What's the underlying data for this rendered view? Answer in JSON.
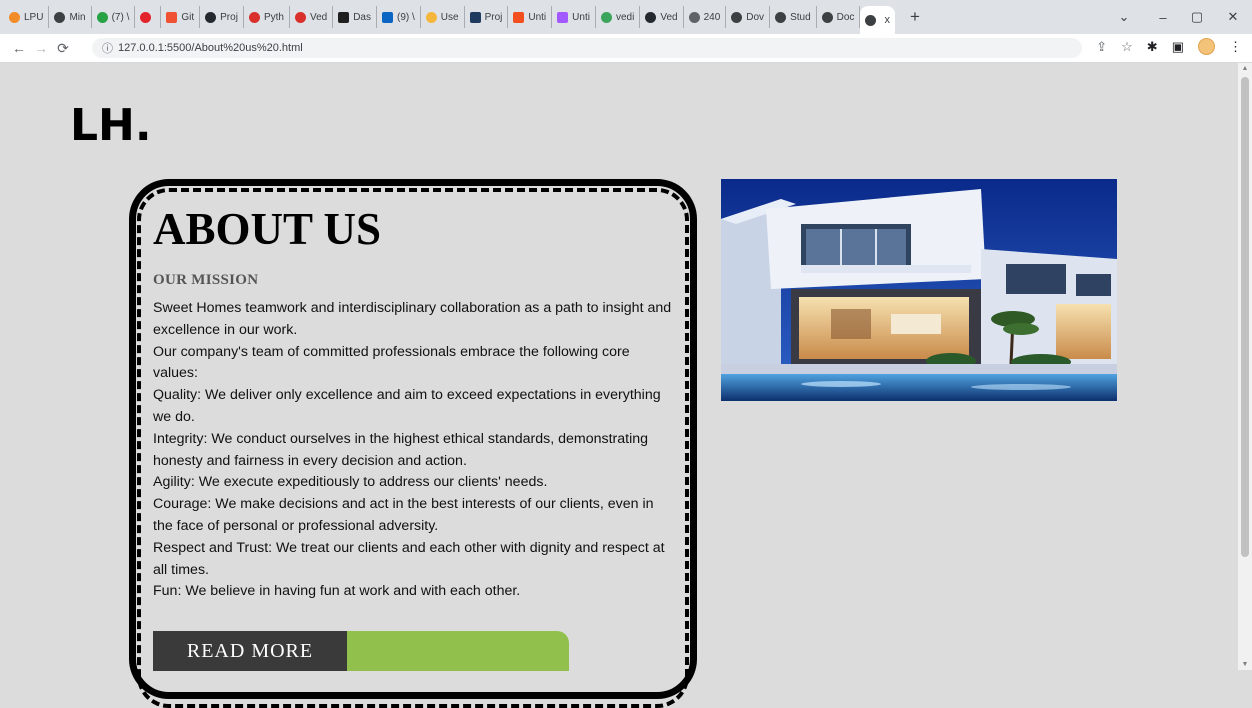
{
  "browser": {
    "tabs": [
      {
        "label": "LPU",
        "color": "#f28c28",
        "sq": false
      },
      {
        "label": "Min",
        "color": "#3c4043",
        "sq": false
      },
      {
        "label": "(7) \\",
        "color": "#25a244",
        "sq": false
      },
      {
        "label": "",
        "color": "#e3242b",
        "sq": false
      },
      {
        "label": "Git",
        "color": "#f05133",
        "sq": true
      },
      {
        "label": "Proj",
        "color": "#24292f",
        "sq": false
      },
      {
        "label": "Pyth",
        "color": "#d9302c",
        "sq": false
      },
      {
        "label": "Ved",
        "color": "#d9302c",
        "sq": false
      },
      {
        "label": "Das",
        "color": "#1f1f1f",
        "sq": true
      },
      {
        "label": "(9) \\",
        "color": "#0a66c2",
        "sq": true
      },
      {
        "label": "Use",
        "color": "#f5b73b",
        "sq": false
      },
      {
        "label": "Proj",
        "color": "#1f3a5f",
        "sq": true
      },
      {
        "label": "Unti",
        "color": "#f24e1e",
        "sq": true
      },
      {
        "label": "Unti",
        "color": "#a259ff",
        "sq": true
      },
      {
        "label": "vedi",
        "color": "#3ba55c",
        "sq": false
      },
      {
        "label": "Ved",
        "color": "#24292f",
        "sq": false
      },
      {
        "label": "240",
        "color": "#5f6368",
        "sq": false
      },
      {
        "label": "Dov",
        "color": "#3c4043",
        "sq": false
      },
      {
        "label": "Stud",
        "color": "#3c4043",
        "sq": false
      },
      {
        "label": "Doc",
        "color": "#3c4043",
        "sq": false
      }
    ],
    "active_tab": {
      "label": "x"
    },
    "new_tab": "+",
    "url": "127.0.0.1:5500/About%20us%20.html",
    "window_controls": {
      "dropdown": "⌄",
      "minimize": "–",
      "maximize": "▢",
      "close": "✕"
    }
  },
  "page": {
    "logo": "LH.",
    "about_title": "ABOUT US",
    "mission_heading": "OUR MISSION",
    "paragraphs": [
      "Sweet Homes teamwork and interdisciplinary collaboration as a path to insight and excellence in our work.",
      "Our company's team of committed professionals embrace the following core values:",
      "Quality: We deliver only excellence and aim to exceed expectations in everything we do.",
      "Integrity: We conduct ourselves in the highest ethical standards, demonstrating honesty and fairness in every decision and action.",
      "Agility: We execute expeditiously to address our clients' needs.",
      "Courage: We make decisions and act in the best interests of our clients, even in the face of personal or professional adversity.",
      "Respect and Trust: We treat our clients and each other with dignity and respect at all times.",
      "Fun: We believe in having fun at work and with each other."
    ],
    "read_more_label": "READ MORE",
    "colors": {
      "background": "#dcdcdc",
      "button_dark": "#3a3a3a",
      "button_accent": "#92c04c"
    }
  }
}
